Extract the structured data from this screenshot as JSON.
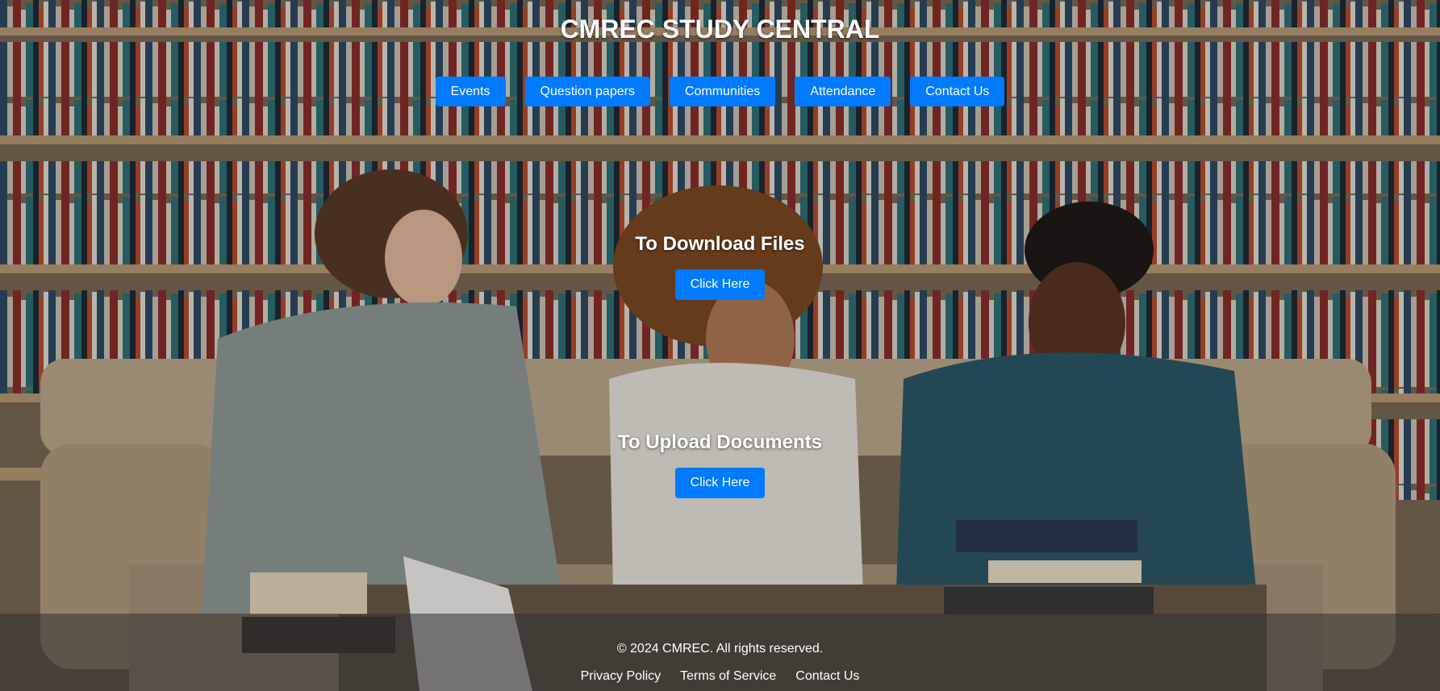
{
  "header": {
    "title": "CMREC STUDY CENTRAL"
  },
  "nav": {
    "items": [
      "Events",
      "Question papers",
      "Communities",
      "Attendance",
      "Contact Us"
    ]
  },
  "download": {
    "heading": "To Download Files",
    "button_label": "Click Here"
  },
  "upload": {
    "heading": "To Upload Documents",
    "button_label": "Click Here"
  },
  "footer": {
    "copyright": "© 2024 CMREC. All rights reserved.",
    "links": [
      "Privacy Policy",
      "Terms of Service",
      "Contact Us"
    ]
  },
  "colors": {
    "accent": "#007bff"
  }
}
